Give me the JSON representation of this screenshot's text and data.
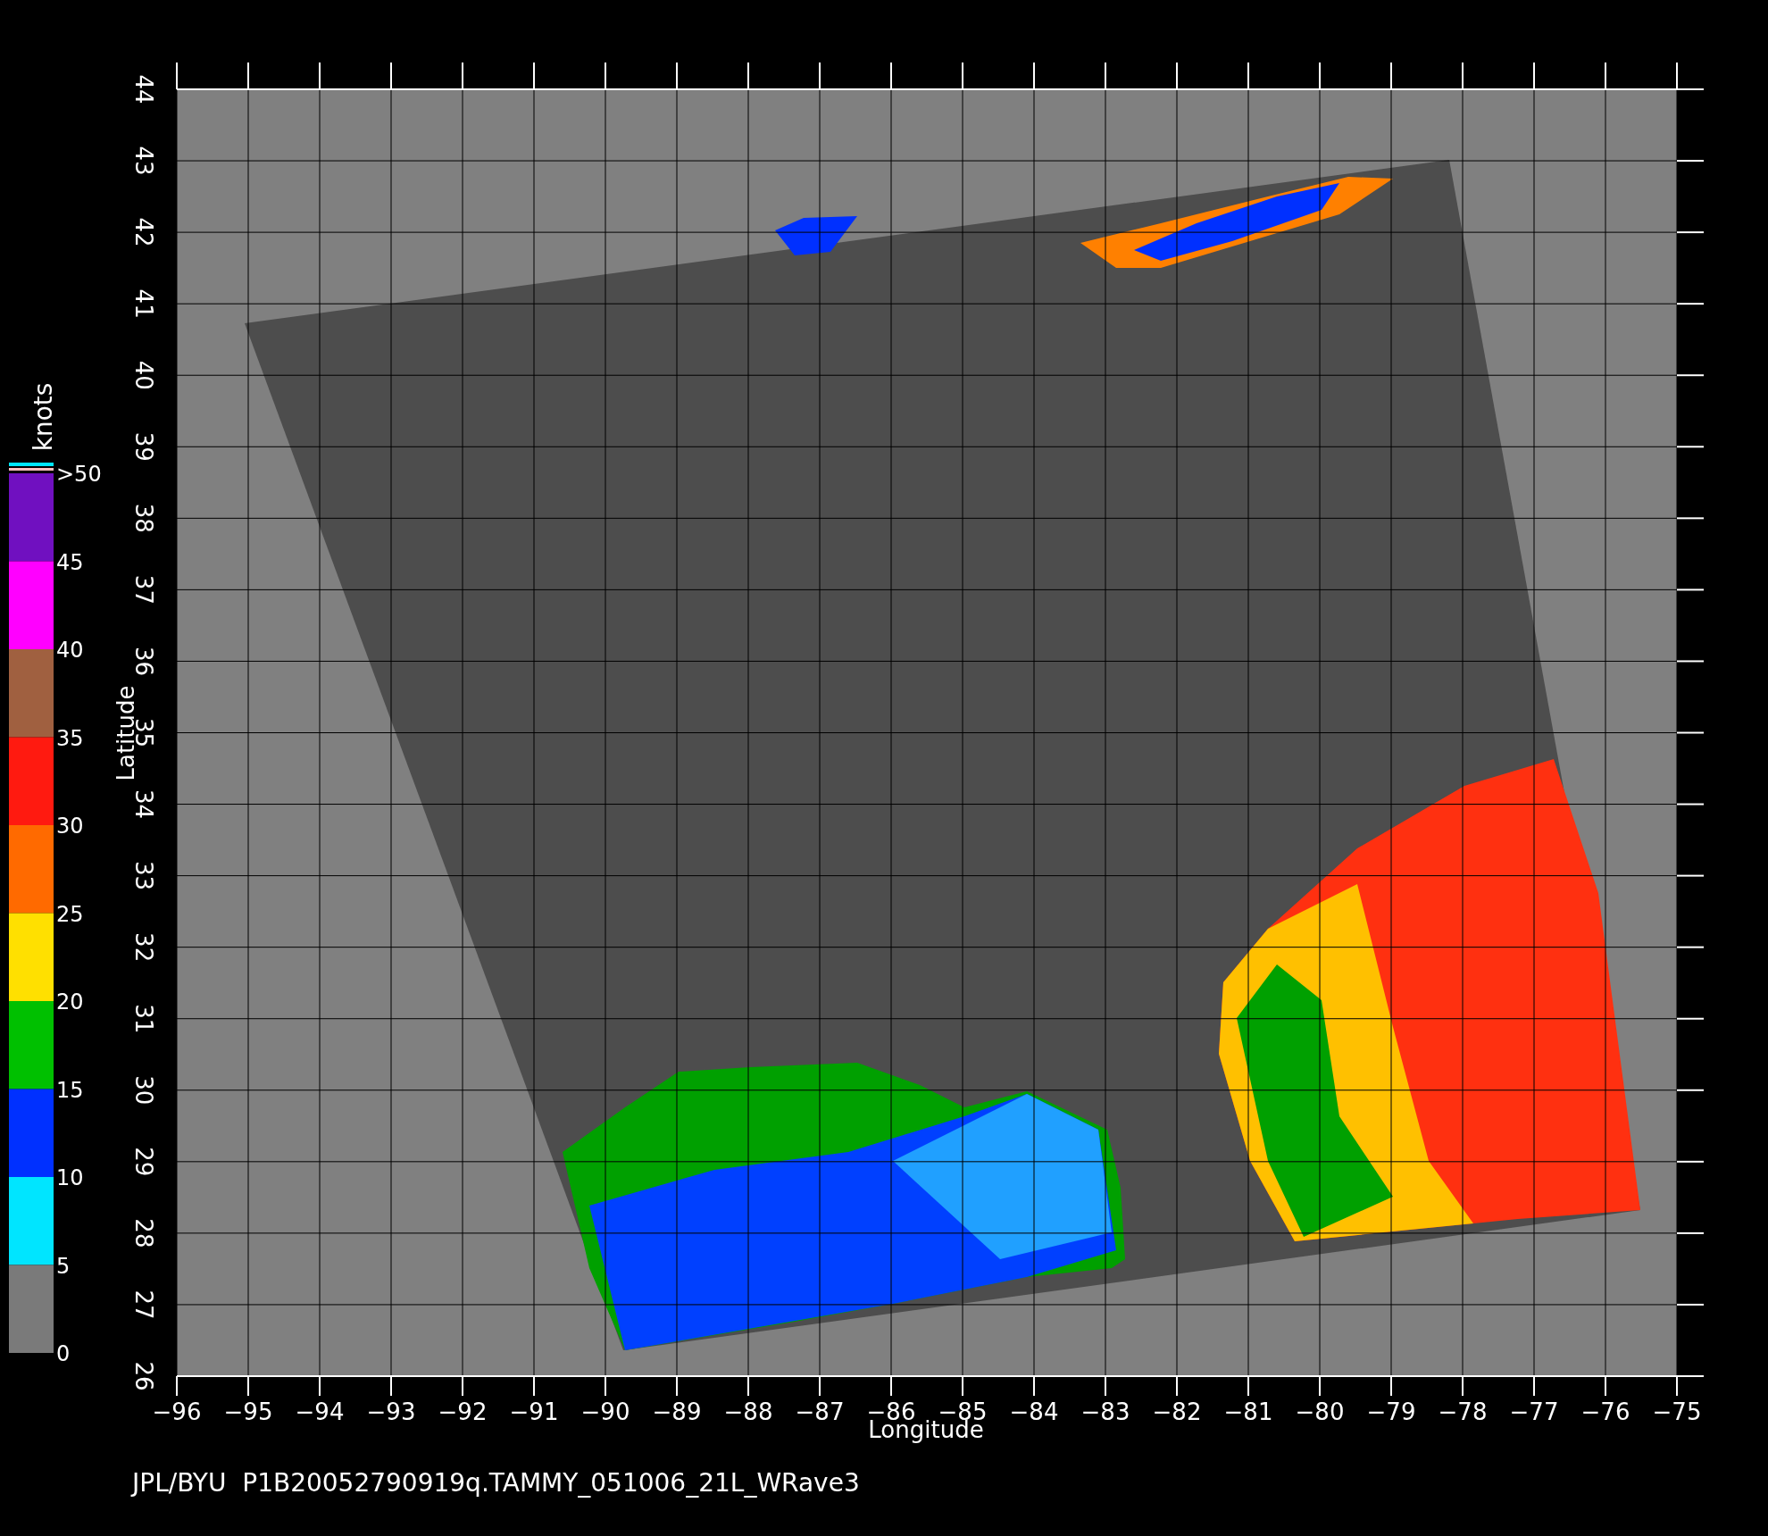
{
  "colorbar": {
    "unit": "knots",
    "bands": [
      {
        "color": "#7010c0"
      },
      {
        "color": "#ff00ff"
      },
      {
        "color": "#a06040"
      },
      {
        "color": "#ff1a10"
      },
      {
        "color": "#ff6a00"
      },
      {
        "color": "#ffe000"
      },
      {
        "color": "#00c000"
      },
      {
        "color": "#0030ff"
      },
      {
        "color": "#00e5ff"
      },
      {
        "color": "#7a7a7a"
      }
    ],
    "labels": [
      ">50",
      "45",
      "40",
      "35",
      "30",
      "25",
      "20",
      "15",
      "10",
      "5",
      "0"
    ]
  },
  "map": {
    "xlabel": "Longitude",
    "ylabel": "Latitude",
    "xticks": [
      "−96",
      "−95",
      "−94",
      "−93",
      "−92",
      "−91",
      "−90",
      "−89",
      "−88",
      "−87",
      "−86",
      "−85",
      "−84",
      "−83",
      "−82",
      "−81",
      "−80",
      "−79",
      "−78",
      "−77",
      "−76",
      "−75"
    ],
    "yticks": [
      "26",
      "27",
      "28",
      "29",
      "30",
      "31",
      "32",
      "33",
      "34",
      "35",
      "36",
      "37",
      "38",
      "39",
      "40",
      "41",
      "42",
      "43",
      "44"
    ]
  },
  "caption": "JPL/BYU  P1B20052790919q.TAMMY_051006_21L_WRave3"
}
